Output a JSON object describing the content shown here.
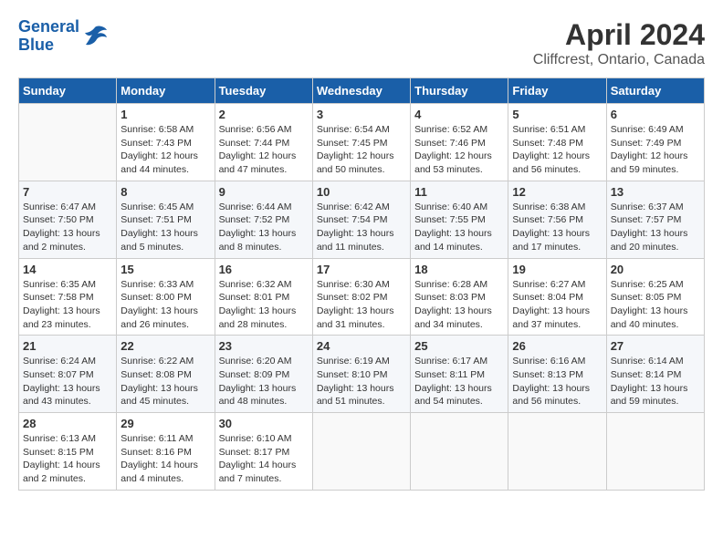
{
  "logo": {
    "line1": "General",
    "line2": "Blue"
  },
  "title": "April 2024",
  "subtitle": "Cliffcrest, Ontario, Canada",
  "weekdays": [
    "Sunday",
    "Monday",
    "Tuesday",
    "Wednesday",
    "Thursday",
    "Friday",
    "Saturday"
  ],
  "weeks": [
    [
      {
        "day": "",
        "data": ""
      },
      {
        "day": "1",
        "data": "Sunrise: 6:58 AM\nSunset: 7:43 PM\nDaylight: 12 hours\nand 44 minutes."
      },
      {
        "day": "2",
        "data": "Sunrise: 6:56 AM\nSunset: 7:44 PM\nDaylight: 12 hours\nand 47 minutes."
      },
      {
        "day": "3",
        "data": "Sunrise: 6:54 AM\nSunset: 7:45 PM\nDaylight: 12 hours\nand 50 minutes."
      },
      {
        "day": "4",
        "data": "Sunrise: 6:52 AM\nSunset: 7:46 PM\nDaylight: 12 hours\nand 53 minutes."
      },
      {
        "day": "5",
        "data": "Sunrise: 6:51 AM\nSunset: 7:48 PM\nDaylight: 12 hours\nand 56 minutes."
      },
      {
        "day": "6",
        "data": "Sunrise: 6:49 AM\nSunset: 7:49 PM\nDaylight: 12 hours\nand 59 minutes."
      }
    ],
    [
      {
        "day": "7",
        "data": "Sunrise: 6:47 AM\nSunset: 7:50 PM\nDaylight: 13 hours\nand 2 minutes."
      },
      {
        "day": "8",
        "data": "Sunrise: 6:45 AM\nSunset: 7:51 PM\nDaylight: 13 hours\nand 5 minutes."
      },
      {
        "day": "9",
        "data": "Sunrise: 6:44 AM\nSunset: 7:52 PM\nDaylight: 13 hours\nand 8 minutes."
      },
      {
        "day": "10",
        "data": "Sunrise: 6:42 AM\nSunset: 7:54 PM\nDaylight: 13 hours\nand 11 minutes."
      },
      {
        "day": "11",
        "data": "Sunrise: 6:40 AM\nSunset: 7:55 PM\nDaylight: 13 hours\nand 14 minutes."
      },
      {
        "day": "12",
        "data": "Sunrise: 6:38 AM\nSunset: 7:56 PM\nDaylight: 13 hours\nand 17 minutes."
      },
      {
        "day": "13",
        "data": "Sunrise: 6:37 AM\nSunset: 7:57 PM\nDaylight: 13 hours\nand 20 minutes."
      }
    ],
    [
      {
        "day": "14",
        "data": "Sunrise: 6:35 AM\nSunset: 7:58 PM\nDaylight: 13 hours\nand 23 minutes."
      },
      {
        "day": "15",
        "data": "Sunrise: 6:33 AM\nSunset: 8:00 PM\nDaylight: 13 hours\nand 26 minutes."
      },
      {
        "day": "16",
        "data": "Sunrise: 6:32 AM\nSunset: 8:01 PM\nDaylight: 13 hours\nand 28 minutes."
      },
      {
        "day": "17",
        "data": "Sunrise: 6:30 AM\nSunset: 8:02 PM\nDaylight: 13 hours\nand 31 minutes."
      },
      {
        "day": "18",
        "data": "Sunrise: 6:28 AM\nSunset: 8:03 PM\nDaylight: 13 hours\nand 34 minutes."
      },
      {
        "day": "19",
        "data": "Sunrise: 6:27 AM\nSunset: 8:04 PM\nDaylight: 13 hours\nand 37 minutes."
      },
      {
        "day": "20",
        "data": "Sunrise: 6:25 AM\nSunset: 8:05 PM\nDaylight: 13 hours\nand 40 minutes."
      }
    ],
    [
      {
        "day": "21",
        "data": "Sunrise: 6:24 AM\nSunset: 8:07 PM\nDaylight: 13 hours\nand 43 minutes."
      },
      {
        "day": "22",
        "data": "Sunrise: 6:22 AM\nSunset: 8:08 PM\nDaylight: 13 hours\nand 45 minutes."
      },
      {
        "day": "23",
        "data": "Sunrise: 6:20 AM\nSunset: 8:09 PM\nDaylight: 13 hours\nand 48 minutes."
      },
      {
        "day": "24",
        "data": "Sunrise: 6:19 AM\nSunset: 8:10 PM\nDaylight: 13 hours\nand 51 minutes."
      },
      {
        "day": "25",
        "data": "Sunrise: 6:17 AM\nSunset: 8:11 PM\nDaylight: 13 hours\nand 54 minutes."
      },
      {
        "day": "26",
        "data": "Sunrise: 6:16 AM\nSunset: 8:13 PM\nDaylight: 13 hours\nand 56 minutes."
      },
      {
        "day": "27",
        "data": "Sunrise: 6:14 AM\nSunset: 8:14 PM\nDaylight: 13 hours\nand 59 minutes."
      }
    ],
    [
      {
        "day": "28",
        "data": "Sunrise: 6:13 AM\nSunset: 8:15 PM\nDaylight: 14 hours\nand 2 minutes."
      },
      {
        "day": "29",
        "data": "Sunrise: 6:11 AM\nSunset: 8:16 PM\nDaylight: 14 hours\nand 4 minutes."
      },
      {
        "day": "30",
        "data": "Sunrise: 6:10 AM\nSunset: 8:17 PM\nDaylight: 14 hours\nand 7 minutes."
      },
      {
        "day": "",
        "data": ""
      },
      {
        "day": "",
        "data": ""
      },
      {
        "day": "",
        "data": ""
      },
      {
        "day": "",
        "data": ""
      }
    ]
  ]
}
